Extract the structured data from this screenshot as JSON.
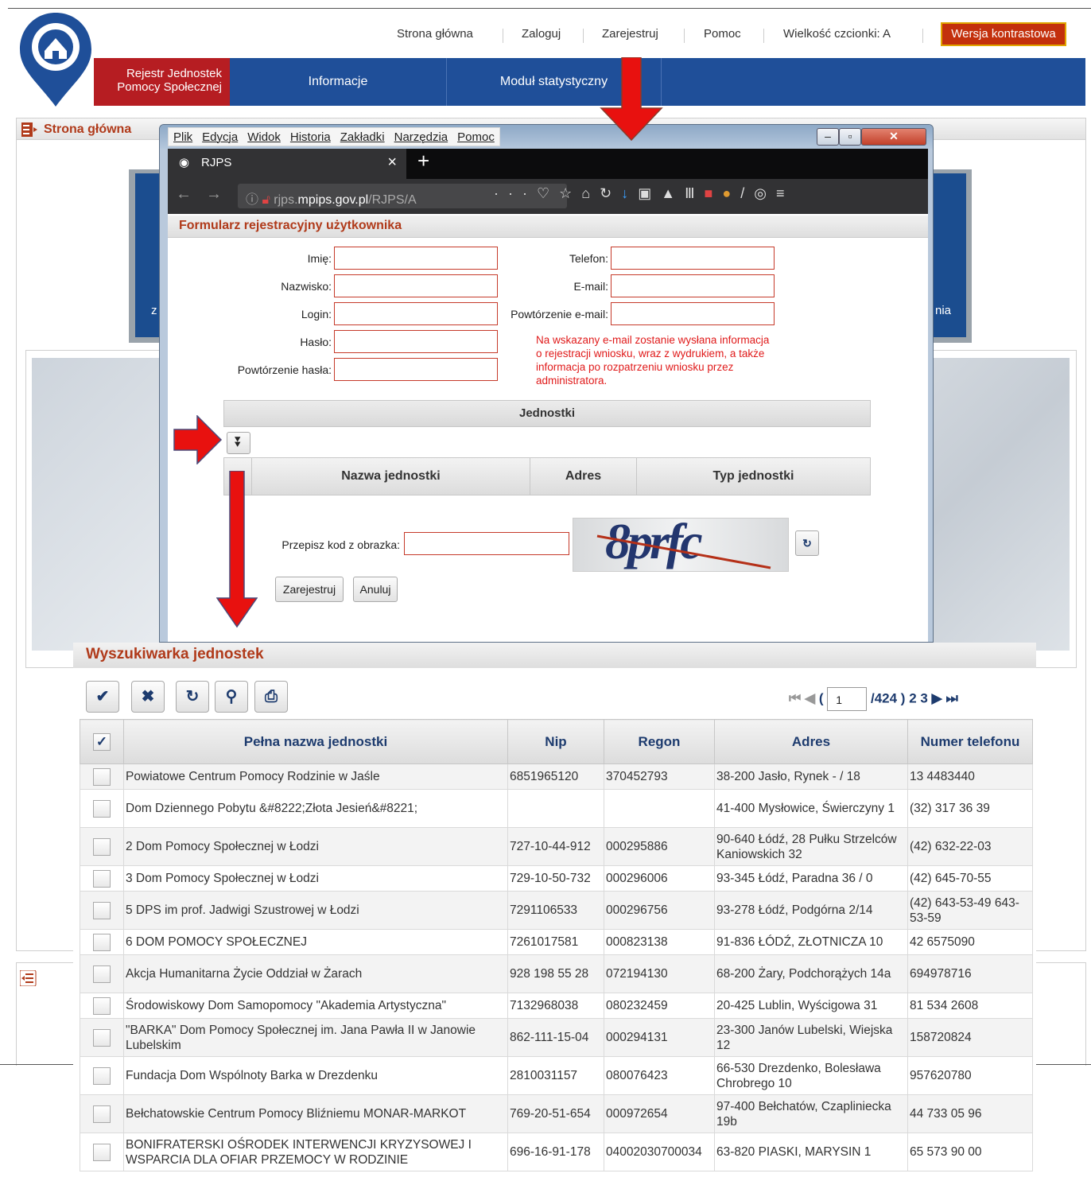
{
  "top_links": {
    "home": "Strona główna",
    "login": "Zaloguj",
    "register": "Zarejestruj",
    "help": "Pomoc",
    "font_size": "Wielkość czcionki: A",
    "contrast": "Wersja kontrastowa"
  },
  "nav": {
    "brand_line1": "Rejestr Jednostek",
    "brand_line2": "Pomocy Społecznej",
    "items": [
      "Informacje",
      "Moduł statystyczny"
    ]
  },
  "breadcrumb": "Strona główna",
  "background_text": {
    "left_fragment": "z",
    "right_fragment": "nia"
  },
  "browser": {
    "menus": [
      "Plik",
      "Edycja",
      "Widok",
      "Historia",
      "Zakładki",
      "Narzędzia",
      "Pomoc"
    ],
    "tab_title": "RJPS",
    "url_prefix": "rjps.",
    "url_host": "mpips.gov.pl",
    "url_rest": "/RJPS/A",
    "new_tab": "+"
  },
  "form": {
    "title": "Formularz rejestracyjny użytkownika",
    "fields_left": [
      "Imię:",
      "Nazwisko:",
      "Login:",
      "Hasło:",
      "Powtórzenie hasła:"
    ],
    "fields_right": [
      "Telefon:",
      "E-mail:",
      "Powtórzenie e-mail:"
    ],
    "note": "Na wskazany e-mail zostanie wysłana informacja o rejestracji wniosku, wraz z wydrukiem, a także informacja po rozpatrzeniu wniosku przez administratora.",
    "units_title": "Jednostki",
    "units_columns": [
      "Nazwa jednostki",
      "Adres",
      "Typ jednostki"
    ],
    "captcha_label": "Przepisz kod z obrazka:",
    "captcha_text": "8prfc",
    "register_button": "Zarejestruj",
    "cancel_button": "Anuluj"
  },
  "search": {
    "title": "Wyszukiwarka jednostek",
    "pager": {
      "current": "1",
      "total": "/424 )",
      "next_pages": [
        "2",
        "3"
      ]
    },
    "columns": [
      "Pełna nazwa jednostki",
      "Nip",
      "Regon",
      "Adres",
      "Numer telefonu"
    ],
    "rows": [
      {
        "name": "Powiatowe Centrum Pomocy Rodzinie w Jaśle",
        "nip": "6851965120",
        "regon": "370452793",
        "address": "38-200 Jasło, Rynek - / 18",
        "phone": "13 4483440"
      },
      {
        "name": "Dom Dziennego Pobytu &#8222;Złota Jesień&#8221;",
        "nip": "",
        "regon": "",
        "address": "41-400 Mysłowice, Świerczyny 1",
        "phone": "(32) 317 36 39"
      },
      {
        "name": "2 Dom Pomocy Społecznej w Łodzi",
        "nip": "727-10-44-912",
        "regon": "000295886",
        "address": "90-640 Łódź, 28 Pułku Strzelców Kaniowskich 32",
        "phone": "(42) 632-22-03"
      },
      {
        "name": "3 Dom Pomocy Społecznej w Łodzi",
        "nip": "729-10-50-732",
        "regon": "000296006",
        "address": "93-345 Łódź, Paradna 36 / 0",
        "phone": "(42) 645-70-55"
      },
      {
        "name": "5 DPS im prof. Jadwigi Szustrowej w Łodzi",
        "nip": "7291106533",
        "regon": "000296756",
        "address": "93-278 Łódź, Podgórna 2/14",
        "phone": "(42) 643-53-49 643-53-59"
      },
      {
        "name": "6 DOM POMOCY SPOŁECZNEJ",
        "nip": "7261017581",
        "regon": "000823138",
        "address": "91-836 ŁÓDŹ, ZŁOTNICZA 10",
        "phone": "42 6575090"
      },
      {
        "name": "Akcja Humanitarna Życie Oddział w Żarach",
        "nip": "928 198 55 28",
        "regon": "072194130",
        "address": "68-200 Żary, Podchorążych 14a",
        "phone": "694978716"
      },
      {
        "name": "Środowiskowy Dom Samopomocy \"Akademia Artystyczna\"",
        "nip": "7132968038",
        "regon": "080232459",
        "address": "20-425 Lublin, Wyścigowa 31",
        "phone": "81 534 2608"
      },
      {
        "name": "\"BARKA\" Dom Pomocy Społecznej im. Jana Pawła II w Janowie Lubelskim",
        "nip": "862-111-15-04",
        "regon": "000294131",
        "address": "23-300 Janów Lubelski, Wiejska 12",
        "phone": "158720824"
      },
      {
        "name": "Fundacja Dom Wspólnoty Barka w Drezdenku",
        "nip": "2810031157",
        "regon": "080076423",
        "address": "66-530 Drezdenko, Bolesława Chrobrego 10",
        "phone": "957620780"
      },
      {
        "name": "Bełchatowskie Centrum Pomocy Bliźniemu MONAR-MARKOT",
        "nip": "769-20-51-654",
        "regon": "000972654",
        "address": "97-400 Bełchatów, Czapliniecka 19b",
        "phone": "44 733 05 96"
      },
      {
        "name": "BONIFRATERSKI OŚRODEK INTERWENCJI KRYZYSOWEJ I WSPARCIA DLA OFIAR PRZEMOCY W RODZINIE",
        "nip": "696-16-91-178",
        "regon": "04002030700034",
        "address": "63-820 PIASKI, MARYSIN 1",
        "phone": "65 573 90 00"
      }
    ]
  },
  "colors": {
    "brand_red": "#b61d22",
    "nav_blue": "#1f4f99",
    "arrow_red": "#e8110f",
    "heading_red": "#b03a1a"
  }
}
